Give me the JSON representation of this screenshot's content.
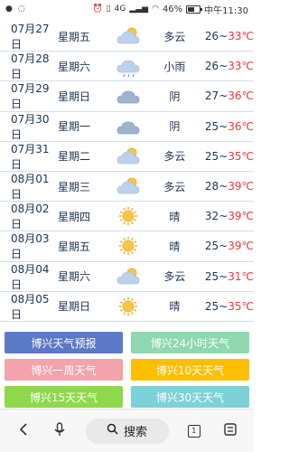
{
  "status_bar": {
    "battery": "46%",
    "time": "中午11:30",
    "network": "4G",
    "signal": "46"
  },
  "days": [
    {
      "date": "07月27日",
      "weekday": "星期五",
      "icon": "partly-cloudy-icon",
      "cond": "多云",
      "low": "26",
      "high": "33℃"
    },
    {
      "date": "07月28日",
      "weekday": "星期六",
      "icon": "light-rain-icon",
      "cond": "小雨",
      "low": "26",
      "high": "33℃"
    },
    {
      "date": "07月29日",
      "weekday": "星期日",
      "icon": "overcast-icon",
      "cond": "阴",
      "low": "27",
      "high": "36℃"
    },
    {
      "date": "07月30日",
      "weekday": "星期一",
      "icon": "overcast-icon",
      "cond": "阴",
      "low": "25",
      "high": "36℃"
    },
    {
      "date": "07月31日",
      "weekday": "星期二",
      "icon": "partly-cloudy-icon",
      "cond": "多云",
      "low": "25",
      "high": "35℃"
    },
    {
      "date": "08月01日",
      "weekday": "星期三",
      "icon": "partly-cloudy-icon",
      "cond": "多云",
      "low": "28",
      "high": "39℃"
    },
    {
      "date": "08月02日",
      "weekday": "星期四",
      "icon": "sunny-icon",
      "cond": "晴",
      "low": "32",
      "high": "39℃"
    },
    {
      "date": "08月03日",
      "weekday": "星期五",
      "icon": "sunny-icon",
      "cond": "晴",
      "low": "25",
      "high": "39℃"
    },
    {
      "date": "08月04日",
      "weekday": "星期六",
      "icon": "partly-cloudy-icon",
      "cond": "多云",
      "low": "25",
      "high": "31℃"
    },
    {
      "date": "08月05日",
      "weekday": "星期日",
      "icon": "sunny-icon",
      "cond": "晴",
      "low": "25",
      "high": "35℃"
    }
  ],
  "buttons": [
    {
      "label": "博兴天气预报",
      "color": "#5b79c7"
    },
    {
      "label": "博兴24小时天气",
      "color": "#8fd8b0"
    },
    {
      "label": "博兴一周天气",
      "color": "#f2a3ab"
    },
    {
      "label": "博兴10天天气",
      "color": "#ffbf00"
    },
    {
      "label": "博兴15天天气",
      "color": "#8fd94c"
    },
    {
      "label": "博兴30天天气",
      "color": "#7dd1d8"
    }
  ],
  "nav": {
    "back_icon": "back-icon",
    "voice_icon": "microphone-icon",
    "search_label": "搜索",
    "tab_count": "1",
    "menu_icon": "menu-icon"
  },
  "colors": {
    "text": "#1f3354",
    "high_temp": "#e53935",
    "divider": "#d7dde6"
  }
}
